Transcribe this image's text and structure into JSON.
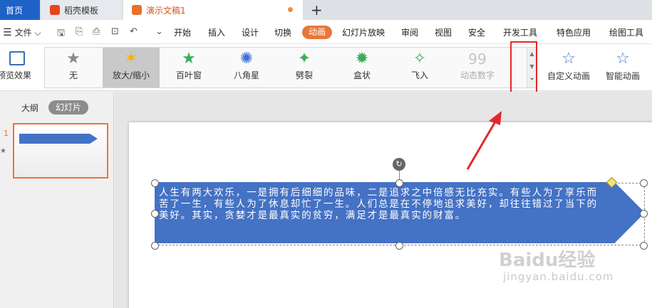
{
  "tabs": {
    "home": "首页",
    "template": "稻壳模板",
    "document": "演示文稿1",
    "add": "+"
  },
  "menu": {
    "file": "文件",
    "items": [
      "开始",
      "插入",
      "设计",
      "切换",
      "动画",
      "幻灯片放映",
      "审阅",
      "视图",
      "安全",
      "开发工具",
      "特色应用",
      "绘图工具"
    ],
    "active": "动画"
  },
  "ribbon": {
    "preview": "预览效果",
    "effects": [
      {
        "label": "无",
        "icon": "star-icon",
        "color": "#8a8a8a"
      },
      {
        "label": "放大/缩小",
        "icon": "zoom-star-icon",
        "color": "#f0b400"
      },
      {
        "label": "百叶窗",
        "icon": "blinds-star-icon",
        "color": "#3cae5a"
      },
      {
        "label": "八角星",
        "icon": "octagram-icon",
        "color": "#3a6fd8"
      },
      {
        "label": "劈裂",
        "icon": "split-star-icon",
        "color": "#3cae5a"
      },
      {
        "label": "盒状",
        "icon": "box-star-icon",
        "color": "#3cae5a"
      },
      {
        "label": "飞入",
        "icon": "fly-star-icon",
        "color": "#3cae5a"
      },
      {
        "label": "动态数字",
        "icon": "number-99-icon",
        "color": "#b8b8b8"
      }
    ],
    "custom_animation": "自定义动画",
    "smart_animation": "智能动画"
  },
  "panel": {
    "outline": "大纲",
    "slides": "幻灯片",
    "slide_number": "1"
  },
  "slide": {
    "text": "人生有两大欢乐，一是拥有后细细的品味，二是追求之中倍感无比充实。有些人为了享乐而苦了一生，有些人为了休息却忙了一生。人们总是在不停地追求美好，却往往错过了当下的美好。其实，贪婪才是最真实的贫穷，满足才是最真实的财富。"
  },
  "watermark": {
    "brand": "Baidu经验",
    "url": "jingyan.baidu.com"
  },
  "colors": {
    "accent": "#e8763a",
    "shape_fill": "#4472c4",
    "highlight_box": "#e3282c",
    "home_tab": "#1e62c7"
  }
}
